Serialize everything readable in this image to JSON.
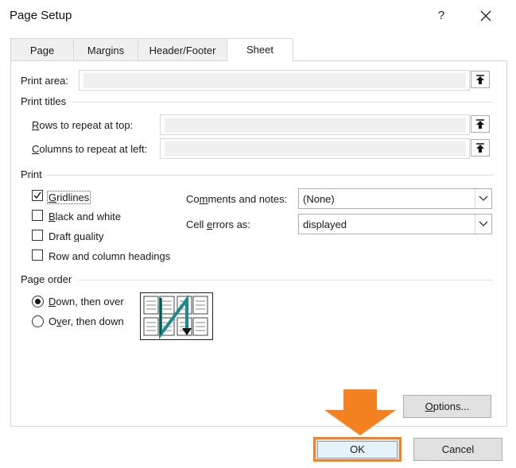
{
  "window": {
    "title": "Page Setup",
    "help_label": "?",
    "close_icon": "close-icon"
  },
  "tabs": [
    {
      "label": "Page",
      "selected": false
    },
    {
      "label": "Margins",
      "selected": false
    },
    {
      "label": "Header/Footer",
      "selected": false
    },
    {
      "label": "Sheet",
      "selected": true
    }
  ],
  "print_area": {
    "label": "Print area:",
    "value": "",
    "button_icon": "collapse-dialog-icon"
  },
  "print_titles": {
    "heading": "Print titles",
    "rows_label_accel": "R",
    "rows_label_rest": "ows to repeat at top:",
    "rows_value": "",
    "columns_label_accel": "C",
    "columns_label_rest": "olumns to repeat at left:",
    "columns_value": ""
  },
  "print": {
    "heading": "Print",
    "gridlines": {
      "accel": "G",
      "rest": "ridlines",
      "checked": true
    },
    "black_white": {
      "accel": "B",
      "rest": "lack and white",
      "checked": false
    },
    "draft": {
      "before": "Draft ",
      "accel": "q",
      "after": "uality",
      "checked": false
    },
    "headings": {
      "label": "Row and column headings",
      "checked": false
    },
    "comments_label_before": "Co",
    "comments_label_accel": "m",
    "comments_label_after": "ments and notes:",
    "comments_value": "(None)",
    "errors_label_before": "Cell ",
    "errors_label_accel": "e",
    "errors_label_after": "rrors as:",
    "errors_value": "displayed"
  },
  "page_order": {
    "heading": "Page order",
    "down_then_over": {
      "accel": "D",
      "rest": "own, then over",
      "selected": true
    },
    "over_then_down": {
      "before": "O",
      "accel": "v",
      "after": "er, then down",
      "selected": false
    },
    "preview_icon": "page-order-preview-icon"
  },
  "buttons": {
    "options_accel": "O",
    "options_rest": "ptions...",
    "ok": "OK",
    "cancel": "Cancel"
  },
  "annotation": {
    "arrow_icon": "down-arrow-icon",
    "color": "#f58220"
  }
}
